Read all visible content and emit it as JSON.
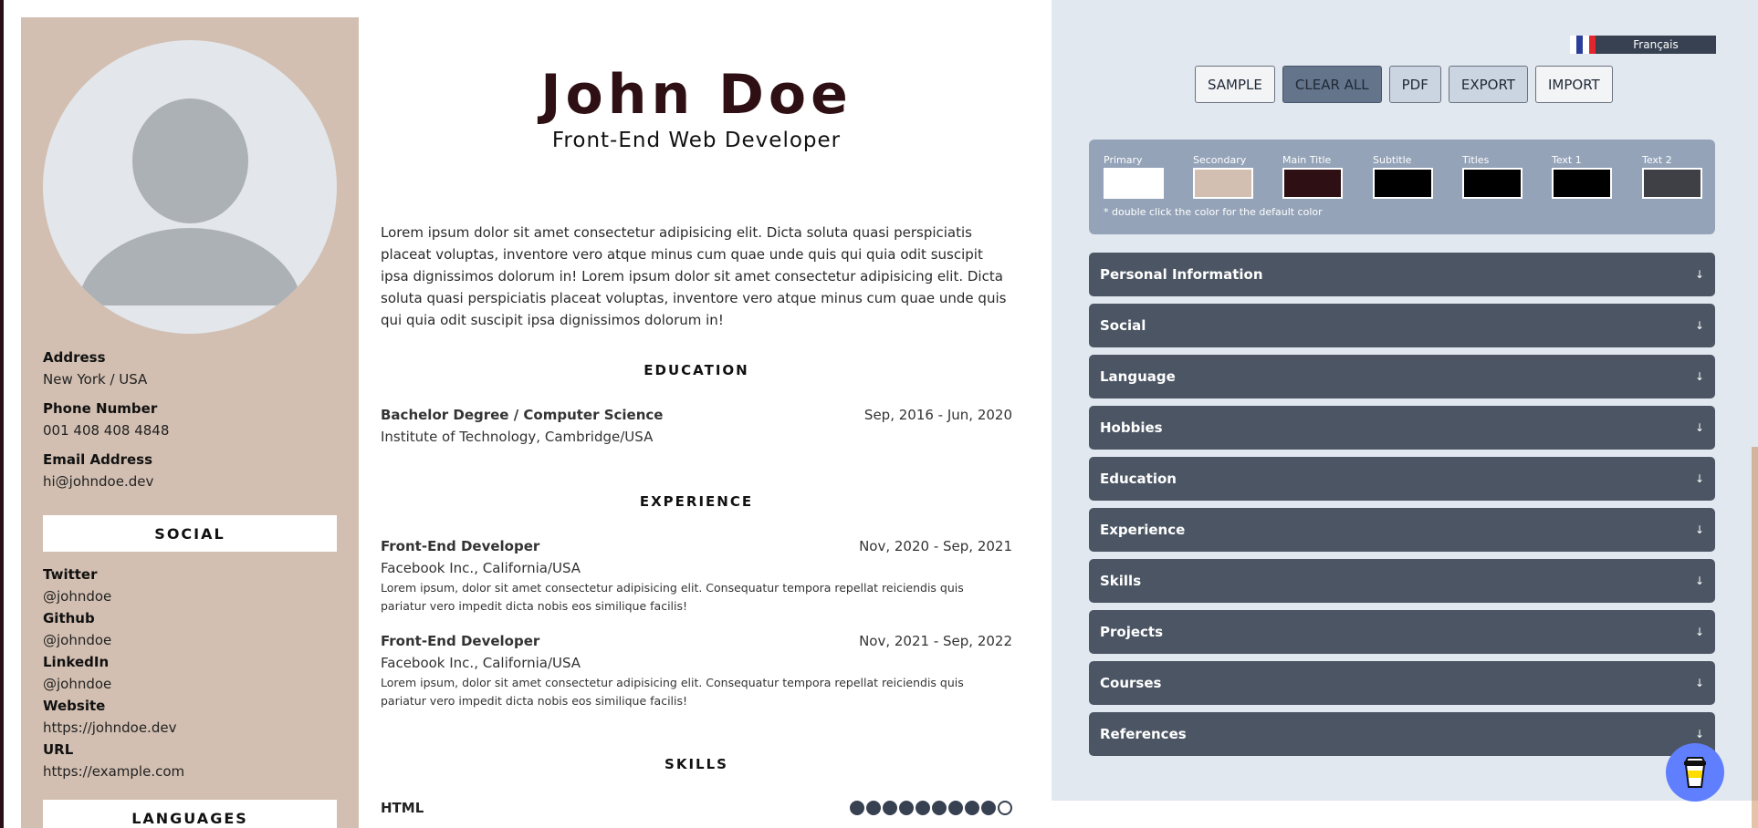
{
  "sidebar": {
    "address_label": "Address",
    "address": "New York / USA",
    "phone_label": "Phone Number",
    "phone": "001 408 408 4848",
    "email_label": "Email Address",
    "email": "hi@johndoe.dev",
    "social_heading": "SOCIAL",
    "social": [
      {
        "label": "Twitter",
        "value": "@johndoe"
      },
      {
        "label": "Github",
        "value": "@johndoe"
      },
      {
        "label": "LinkedIn",
        "value": "@johndoe"
      },
      {
        "label": "Website",
        "value": "https://johndoe.dev"
      },
      {
        "label": "URL",
        "value": "https://example.com"
      }
    ],
    "languages_heading": "LANGUAGES"
  },
  "main": {
    "name": "John Doe",
    "role": "Front-End Web Developer",
    "summary": "Lorem ipsum dolor sit amet consectetur adipisicing elit. Dicta soluta quasi perspiciatis placeat voluptas, inventore vero atque minus cum quae unde quis qui quia odit suscipit ipsa dignissimos dolorum in! Lorem ipsum dolor sit amet consectetur adipisicing elit. Dicta soluta quasi perspiciatis placeat voluptas, inventore vero atque minus cum quae unde quis qui quia odit suscipit ipsa dignissimos dolorum in!",
    "education_heading": "EDUCATION",
    "education": [
      {
        "title": "Bachelor Degree / Computer Science",
        "date": "Sep, 2016 - Jun, 2020",
        "place": "Institute of Technology, Cambridge/USA"
      }
    ],
    "experience_heading": "EXPERIENCE",
    "experience": [
      {
        "title": "Front-End Developer",
        "date": "Nov, 2020 - Sep, 2021",
        "place": "Facebook Inc., California/USA",
        "desc": "Lorem ipsum, dolor sit amet consectetur adipisicing elit. Consequatur tempora repellat reiciendis quis pariatur vero impedit dicta nobis eos similique facilis!"
      },
      {
        "title": "Front-End Developer",
        "date": "Nov, 2021 - Sep, 2022",
        "place": "Facebook Inc., California/USA",
        "desc": "Lorem ipsum, dolor sit amet consectetur adipisicing elit. Consequatur tempora repellat reiciendis quis pariatur vero impedit dicta nobis eos similique facilis!"
      }
    ],
    "skills_heading": "SKILLS",
    "skills": [
      {
        "name": "HTML",
        "level": 9,
        "max": 10
      }
    ]
  },
  "editor": {
    "language_button": "Français",
    "toolbar": {
      "sample": "SAMPLE",
      "clear_all": "CLEAR ALL",
      "pdf": "PDF",
      "export": "EXPORT",
      "import": "IMPORT"
    },
    "colors": [
      {
        "label": "Primary",
        "value": "#ffffff"
      },
      {
        "label": "Secondary",
        "value": "#d2bfb1"
      },
      {
        "label": "Main Title",
        "value": "#2e0f14"
      },
      {
        "label": "Subtitle",
        "value": "#000000"
      },
      {
        "label": "Titles",
        "value": "#000000"
      },
      {
        "label": "Text 1",
        "value": "#000000"
      },
      {
        "label": "Text 2",
        "value": "#3f3f46"
      }
    ],
    "colors_hint": "* double click the color for the default color",
    "sections": [
      "Personal Information",
      "Social",
      "Language",
      "Hobbies",
      "Education",
      "Experience",
      "Skills",
      "Projects",
      "Courses",
      "References"
    ],
    "section_arrow": "↓"
  },
  "icons": {
    "avatar": "user-placeholder-icon",
    "flag": "french-flag-icon",
    "coffee": "coffee-cup-icon"
  },
  "theme": {
    "accent": "#5f7fff",
    "panel": "#4b5563",
    "sidebar_bg": "#d2bfb1",
    "main_title": "#2e0f14"
  }
}
